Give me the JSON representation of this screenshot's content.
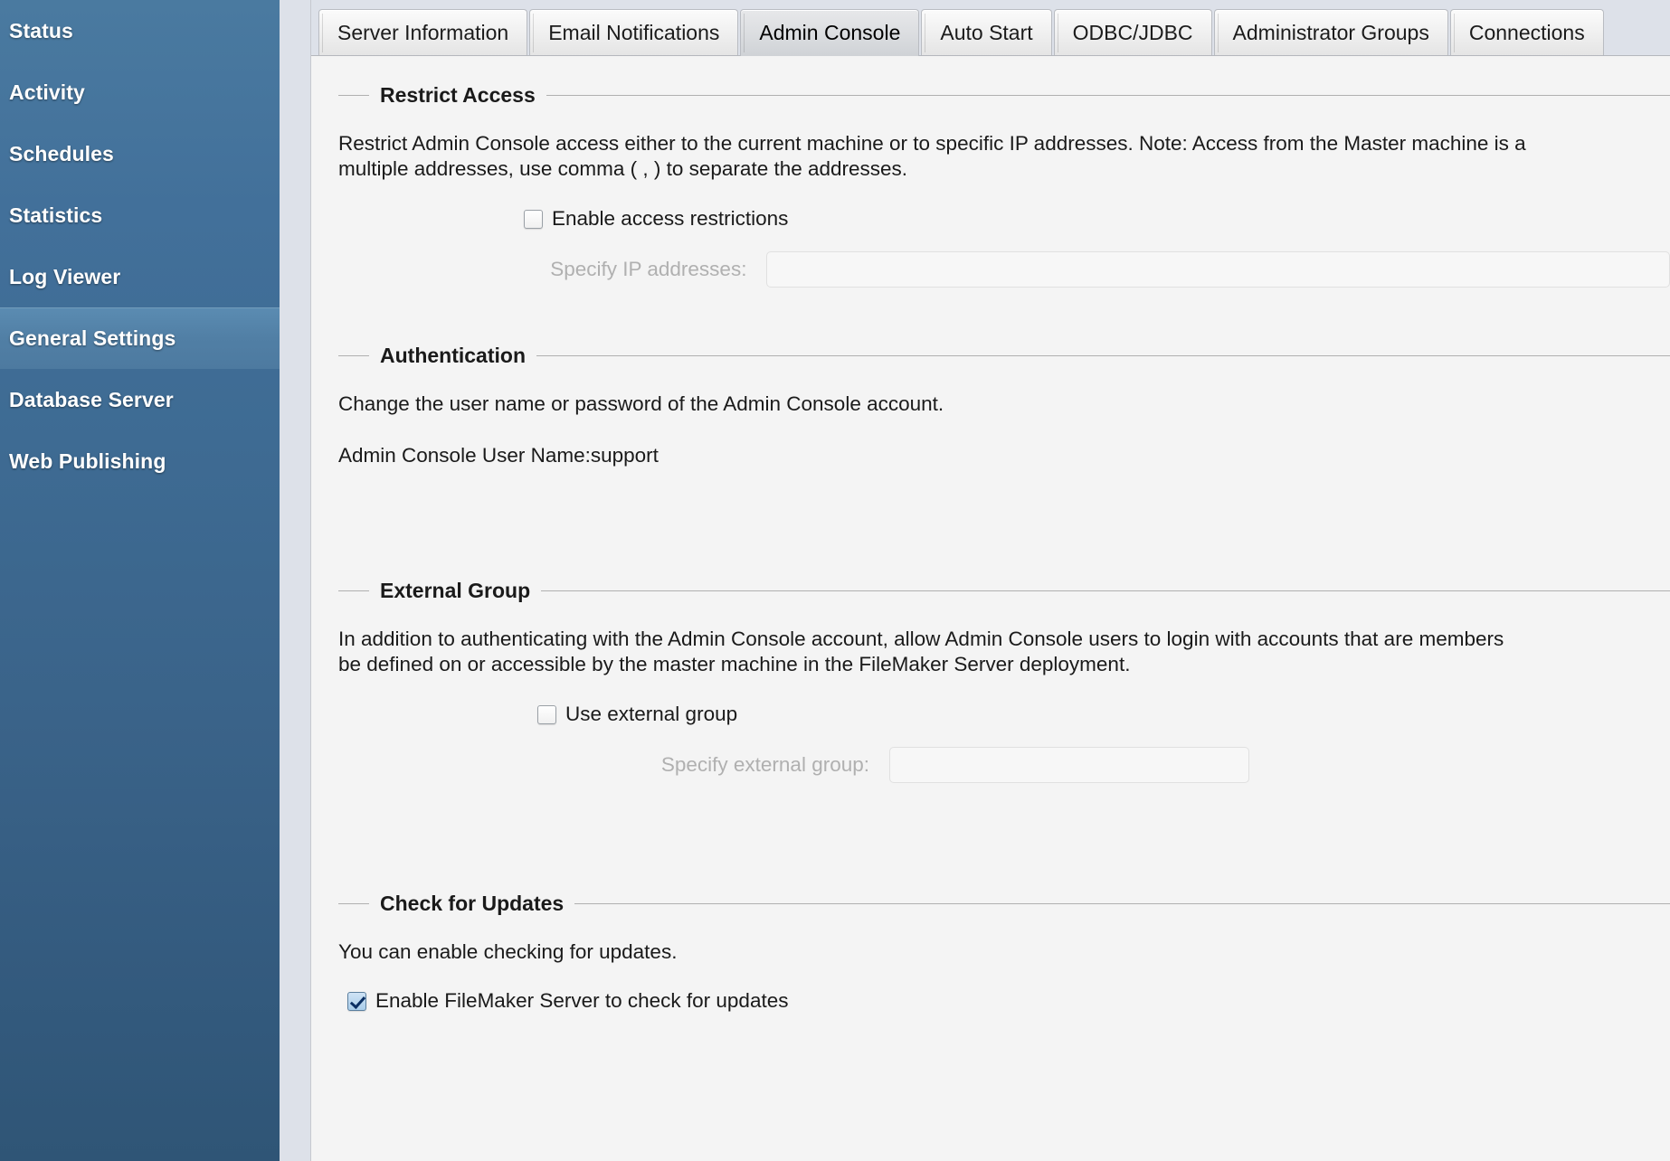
{
  "sidebar": {
    "items": [
      {
        "label": "Status",
        "selected": false
      },
      {
        "label": "Activity",
        "selected": false
      },
      {
        "label": "Schedules",
        "selected": false
      },
      {
        "label": "Statistics",
        "selected": false
      },
      {
        "label": "Log Viewer",
        "selected": false
      },
      {
        "label": "General Settings",
        "selected": true
      },
      {
        "label": "Database Server",
        "selected": false
      },
      {
        "label": "Web Publishing",
        "selected": false
      }
    ],
    "colors": {
      "top": "#4a7aa0",
      "bottom": "#2f5576",
      "selected": "#517fa5"
    }
  },
  "tabs": [
    {
      "label": "Server Information",
      "active": false
    },
    {
      "label": "Email Notifications",
      "active": false
    },
    {
      "label": "Admin Console",
      "active": true
    },
    {
      "label": "Auto Start",
      "active": false
    },
    {
      "label": "ODBC/JDBC",
      "active": false
    },
    {
      "label": "Administrator Groups",
      "active": false
    },
    {
      "label": "Connections",
      "active": false
    }
  ],
  "restrict_access": {
    "title": "Restrict Access",
    "description_line1": "Restrict Admin Console access either to the current machine or to specific IP addresses. Note: Access from the Master machine is a",
    "description_line2": "multiple addresses, use comma ( , ) to separate the addresses.",
    "enable_checkbox_label": "Enable access restrictions",
    "enable_checkbox_checked": false,
    "ip_label": "Specify IP addresses:",
    "ip_value": "",
    "ip_placeholder": ""
  },
  "authentication": {
    "title": "Authentication",
    "description": "Change the user name or password of the Admin Console account.",
    "user_name_label": "Admin Console User Name:",
    "user_name_value": "support"
  },
  "external_group": {
    "title": "External Group",
    "description_line1": "In addition to authenticating with the Admin Console account, allow Admin Console users to login with accounts that are members",
    "description_line2": "be defined on or accessible by the master machine in the FileMaker Server deployment.",
    "use_checkbox_label": "Use external group",
    "use_checkbox_checked": false,
    "group_label": "Specify external group:",
    "group_value": "",
    "group_placeholder": ""
  },
  "check_for_updates": {
    "title": "Check for Updates",
    "description": "You can enable checking for updates.",
    "enable_checkbox_label": "Enable FileMaker Server to check for updates",
    "enable_checkbox_checked": true
  }
}
